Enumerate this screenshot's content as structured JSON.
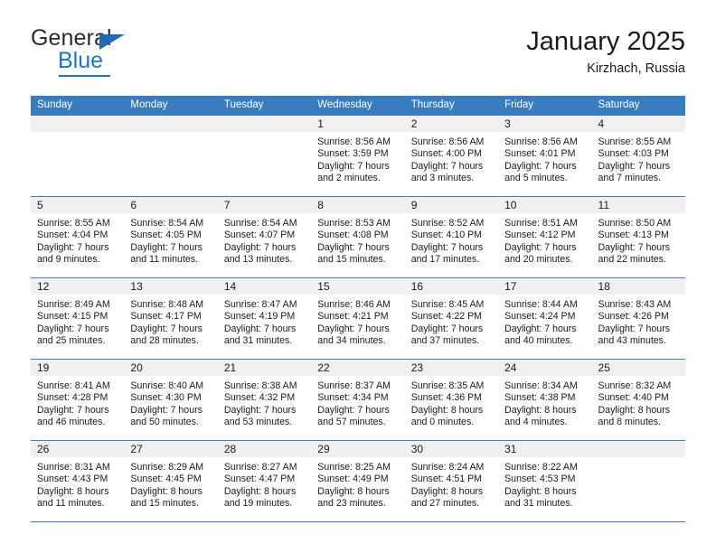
{
  "brand": {
    "name_top": "General",
    "name_bottom": "Blue",
    "triangle_color": "#1f6ab4",
    "blue_color": "#1b74c4"
  },
  "header": {
    "title": "January 2025",
    "subtitle": "Kirzhach, Russia"
  },
  "theme": {
    "header_blue": "#3a7cc0",
    "daynum_band": "#f0f0f0",
    "text": "#1a1a1a"
  },
  "calendar": {
    "weekday_headers": [
      "Sunday",
      "Monday",
      "Tuesday",
      "Wednesday",
      "Thursday",
      "Friday",
      "Saturday"
    ],
    "weeks": [
      [
        {
          "day": "",
          "empty": true,
          "lines": []
        },
        {
          "day": "",
          "empty": true,
          "lines": []
        },
        {
          "day": "",
          "empty": true,
          "lines": []
        },
        {
          "day": "1",
          "empty": false,
          "lines": [
            "Sunrise: 8:56 AM",
            "Sunset: 3:59 PM",
            "Daylight: 7 hours",
            "and 2 minutes."
          ]
        },
        {
          "day": "2",
          "empty": false,
          "lines": [
            "Sunrise: 8:56 AM",
            "Sunset: 4:00 PM",
            "Daylight: 7 hours",
            "and 3 minutes."
          ]
        },
        {
          "day": "3",
          "empty": false,
          "lines": [
            "Sunrise: 8:56 AM",
            "Sunset: 4:01 PM",
            "Daylight: 7 hours",
            "and 5 minutes."
          ]
        },
        {
          "day": "4",
          "empty": false,
          "lines": [
            "Sunrise: 8:55 AM",
            "Sunset: 4:03 PM",
            "Daylight: 7 hours",
            "and 7 minutes."
          ]
        }
      ],
      [
        {
          "day": "5",
          "empty": false,
          "lines": [
            "Sunrise: 8:55 AM",
            "Sunset: 4:04 PM",
            "Daylight: 7 hours",
            "and 9 minutes."
          ]
        },
        {
          "day": "6",
          "empty": false,
          "lines": [
            "Sunrise: 8:54 AM",
            "Sunset: 4:05 PM",
            "Daylight: 7 hours",
            "and 11 minutes."
          ]
        },
        {
          "day": "7",
          "empty": false,
          "lines": [
            "Sunrise: 8:54 AM",
            "Sunset: 4:07 PM",
            "Daylight: 7 hours",
            "and 13 minutes."
          ]
        },
        {
          "day": "8",
          "empty": false,
          "lines": [
            "Sunrise: 8:53 AM",
            "Sunset: 4:08 PM",
            "Daylight: 7 hours",
            "and 15 minutes."
          ]
        },
        {
          "day": "9",
          "empty": false,
          "lines": [
            "Sunrise: 8:52 AM",
            "Sunset: 4:10 PM",
            "Daylight: 7 hours",
            "and 17 minutes."
          ]
        },
        {
          "day": "10",
          "empty": false,
          "lines": [
            "Sunrise: 8:51 AM",
            "Sunset: 4:12 PM",
            "Daylight: 7 hours",
            "and 20 minutes."
          ]
        },
        {
          "day": "11",
          "empty": false,
          "lines": [
            "Sunrise: 8:50 AM",
            "Sunset: 4:13 PM",
            "Daylight: 7 hours",
            "and 22 minutes."
          ]
        }
      ],
      [
        {
          "day": "12",
          "empty": false,
          "lines": [
            "Sunrise: 8:49 AM",
            "Sunset: 4:15 PM",
            "Daylight: 7 hours",
            "and 25 minutes."
          ]
        },
        {
          "day": "13",
          "empty": false,
          "lines": [
            "Sunrise: 8:48 AM",
            "Sunset: 4:17 PM",
            "Daylight: 7 hours",
            "and 28 minutes."
          ]
        },
        {
          "day": "14",
          "empty": false,
          "lines": [
            "Sunrise: 8:47 AM",
            "Sunset: 4:19 PM",
            "Daylight: 7 hours",
            "and 31 minutes."
          ]
        },
        {
          "day": "15",
          "empty": false,
          "lines": [
            "Sunrise: 8:46 AM",
            "Sunset: 4:21 PM",
            "Daylight: 7 hours",
            "and 34 minutes."
          ]
        },
        {
          "day": "16",
          "empty": false,
          "lines": [
            "Sunrise: 8:45 AM",
            "Sunset: 4:22 PM",
            "Daylight: 7 hours",
            "and 37 minutes."
          ]
        },
        {
          "day": "17",
          "empty": false,
          "lines": [
            "Sunrise: 8:44 AM",
            "Sunset: 4:24 PM",
            "Daylight: 7 hours",
            "and 40 minutes."
          ]
        },
        {
          "day": "18",
          "empty": false,
          "lines": [
            "Sunrise: 8:43 AM",
            "Sunset: 4:26 PM",
            "Daylight: 7 hours",
            "and 43 minutes."
          ]
        }
      ],
      [
        {
          "day": "19",
          "empty": false,
          "lines": [
            "Sunrise: 8:41 AM",
            "Sunset: 4:28 PM",
            "Daylight: 7 hours",
            "and 46 minutes."
          ]
        },
        {
          "day": "20",
          "empty": false,
          "lines": [
            "Sunrise: 8:40 AM",
            "Sunset: 4:30 PM",
            "Daylight: 7 hours",
            "and 50 minutes."
          ]
        },
        {
          "day": "21",
          "empty": false,
          "lines": [
            "Sunrise: 8:38 AM",
            "Sunset: 4:32 PM",
            "Daylight: 7 hours",
            "and 53 minutes."
          ]
        },
        {
          "day": "22",
          "empty": false,
          "lines": [
            "Sunrise: 8:37 AM",
            "Sunset: 4:34 PM",
            "Daylight: 7 hours",
            "and 57 minutes."
          ]
        },
        {
          "day": "23",
          "empty": false,
          "lines": [
            "Sunrise: 8:35 AM",
            "Sunset: 4:36 PM",
            "Daylight: 8 hours",
            "and 0 minutes."
          ]
        },
        {
          "day": "24",
          "empty": false,
          "lines": [
            "Sunrise: 8:34 AM",
            "Sunset: 4:38 PM",
            "Daylight: 8 hours",
            "and 4 minutes."
          ]
        },
        {
          "day": "25",
          "empty": false,
          "lines": [
            "Sunrise: 8:32 AM",
            "Sunset: 4:40 PM",
            "Daylight: 8 hours",
            "and 8 minutes."
          ]
        }
      ],
      [
        {
          "day": "26",
          "empty": false,
          "lines": [
            "Sunrise: 8:31 AM",
            "Sunset: 4:43 PM",
            "Daylight: 8 hours",
            "and 11 minutes."
          ]
        },
        {
          "day": "27",
          "empty": false,
          "lines": [
            "Sunrise: 8:29 AM",
            "Sunset: 4:45 PM",
            "Daylight: 8 hours",
            "and 15 minutes."
          ]
        },
        {
          "day": "28",
          "empty": false,
          "lines": [
            "Sunrise: 8:27 AM",
            "Sunset: 4:47 PM",
            "Daylight: 8 hours",
            "and 19 minutes."
          ]
        },
        {
          "day": "29",
          "empty": false,
          "lines": [
            "Sunrise: 8:25 AM",
            "Sunset: 4:49 PM",
            "Daylight: 8 hours",
            "and 23 minutes."
          ]
        },
        {
          "day": "30",
          "empty": false,
          "lines": [
            "Sunrise: 8:24 AM",
            "Sunset: 4:51 PM",
            "Daylight: 8 hours",
            "and 27 minutes."
          ]
        },
        {
          "day": "31",
          "empty": false,
          "lines": [
            "Sunrise: 8:22 AM",
            "Sunset: 4:53 PM",
            "Daylight: 8 hours",
            "and 31 minutes."
          ]
        },
        {
          "day": "",
          "empty": true,
          "lines": []
        }
      ]
    ]
  }
}
